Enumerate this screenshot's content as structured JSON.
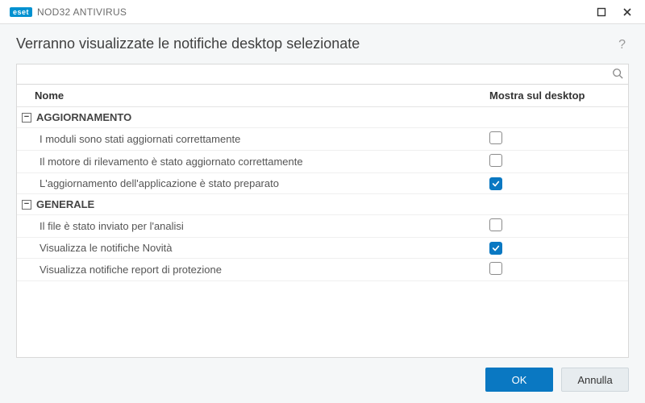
{
  "window": {
    "brand_badge": "eset",
    "brand_text": "NOD32 ANTIVIRUS"
  },
  "page": {
    "title": "Verranno visualizzate le notifiche desktop selezionate",
    "help": "?"
  },
  "search": {
    "value": "",
    "placeholder": ""
  },
  "columns": {
    "name": "Nome",
    "show": "Mostra sul desktop"
  },
  "groups": [
    {
      "label": "AGGIORNAMENTO",
      "expanded": true,
      "items": [
        {
          "name": "I moduli sono stati aggiornati correttamente",
          "checked": false
        },
        {
          "name": "Il motore di rilevamento è stato aggiornato correttamente",
          "checked": false
        },
        {
          "name": "L'aggiornamento dell'applicazione è stato preparato",
          "checked": true
        }
      ]
    },
    {
      "label": "GENERALE",
      "expanded": true,
      "items": [
        {
          "name": "Il file è stato inviato per l'analisi",
          "checked": false
        },
        {
          "name": "Visualizza le notifiche Novità",
          "checked": true
        },
        {
          "name": "Visualizza notifiche report di protezione",
          "checked": false
        }
      ]
    }
  ],
  "buttons": {
    "ok": "OK",
    "cancel": "Annulla"
  },
  "icons": {
    "collapse": "−"
  }
}
